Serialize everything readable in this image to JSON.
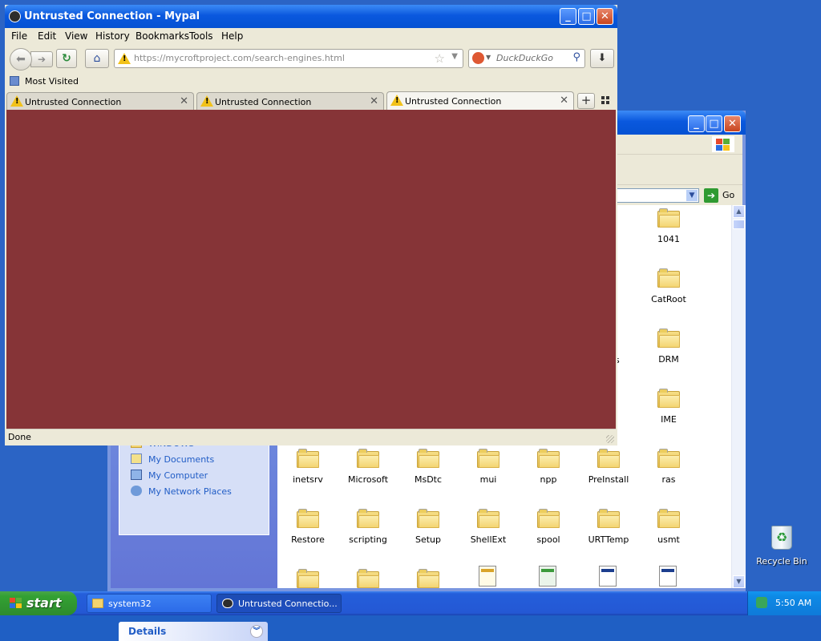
{
  "firefox": {
    "title": "Untrusted Connection - Mypal",
    "menus": [
      "File",
      "Edit",
      "View",
      "History",
      "Bookmarks",
      "Tools",
      "Help"
    ],
    "url_scheme_host": "https://mycroftproject.com",
    "url_path": "/search-engines.html",
    "search_placeholder": "DuckDuckGo",
    "bookmarks_toolbar": {
      "most_visited": "Most Visited"
    },
    "tabs": [
      {
        "label": "Untrusted Connection",
        "active": false
      },
      {
        "label": "Untrusted Connection",
        "active": false
      },
      {
        "label": "Untrusted Connection",
        "active": true
      }
    ],
    "status": "Done",
    "content_color": "#863437"
  },
  "explorer": {
    "go_label": "Go",
    "places": [
      "WINDOWS",
      "My Documents",
      "My Computer",
      "My Network Places"
    ],
    "details_label": "Details",
    "right_column_folders": [
      "1041",
      "CatRoot",
      "DRM",
      "IME"
    ],
    "partial_labels": [
      "s"
    ],
    "folder_row_1": [
      "inetsrv",
      "Microsoft",
      "MsDtc",
      "mui",
      "npp",
      "PreInstall",
      "ras"
    ],
    "folder_row_2": [
      "Restore",
      "scripting",
      "Setup",
      "ShellExt",
      "spool",
      "URTTemp",
      "usmt"
    ]
  },
  "desktop": {
    "recycle_bin": "Recycle Bin"
  },
  "taskbar": {
    "start": "start",
    "tasks": [
      {
        "label": "system32",
        "icon": "folder-icon",
        "active": false
      },
      {
        "label": "Untrusted Connectio...",
        "icon": "mypal-icon",
        "active": true
      }
    ],
    "clock": "5:50 AM"
  }
}
